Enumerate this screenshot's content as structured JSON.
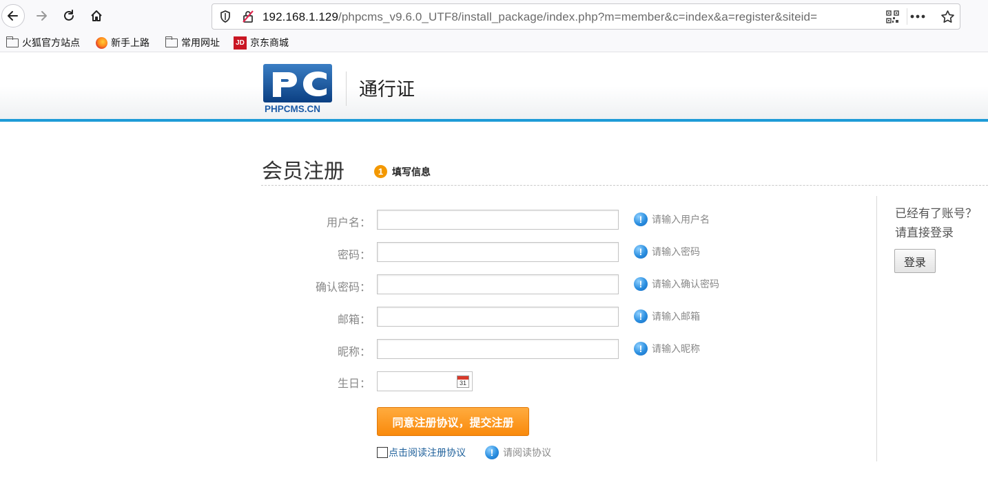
{
  "browser": {
    "url_host": "192.168.1.129",
    "url_path": "/phpcms_v9.6.0_UTF8/install_package/index.php?m=member&c=index&a=register&siteid=",
    "bookmarks": [
      {
        "label": "火狐官方站点",
        "icon": "folder-icon"
      },
      {
        "label": "新手上路",
        "icon": "firefox-icon"
      },
      {
        "label": "常用网址",
        "icon": "folder-icon"
      },
      {
        "label": "京东商城",
        "icon": "jd-icon"
      }
    ],
    "jd_icon_text": "JD"
  },
  "header": {
    "logo_text": "PHPCMS.CN",
    "title": "通行证",
    "accent_color": "#1e9bd7"
  },
  "register": {
    "title": "会员注册",
    "step_number": "1",
    "step_label": "填写信息"
  },
  "form": {
    "fields": [
      {
        "label": "用户名：",
        "hint": "请输入用户名"
      },
      {
        "label": "密码：",
        "hint": "请输入密码"
      },
      {
        "label": "确认密码：",
        "hint": "请输入确认密码"
      },
      {
        "label": "邮箱：",
        "hint": "请输入邮箱"
      },
      {
        "label": "昵称：",
        "hint": "请输入昵称"
      }
    ],
    "birthday_label": "生日：",
    "calendar_day": "31",
    "submit_label": "同意注册协议，提交注册",
    "agreement_link": "点击阅读注册协议",
    "agreement_hint": "请阅读协议",
    "info_icon_glyph": "!"
  },
  "sidebar": {
    "line1": "已经有了账号？",
    "line2": "请直接登录",
    "login_label": "登录"
  }
}
